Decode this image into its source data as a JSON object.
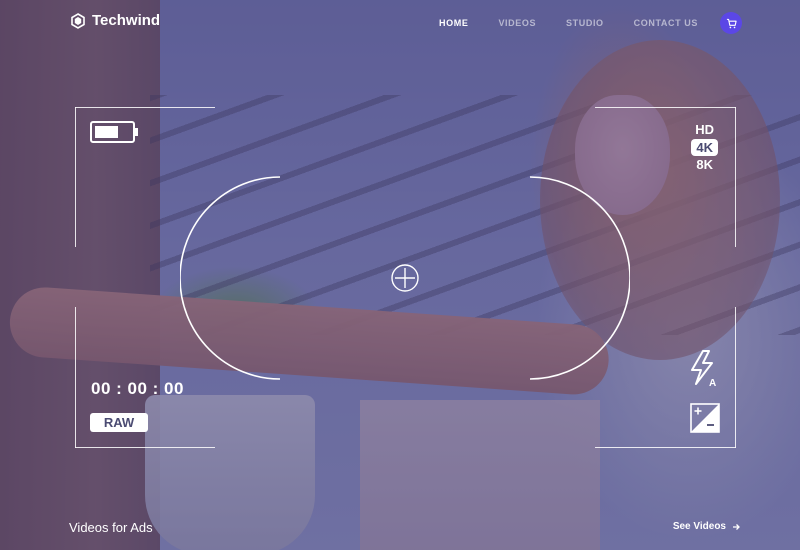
{
  "brand": {
    "name": "Techwind",
    "logo_icon": "techwind-logo-icon"
  },
  "nav": {
    "items": [
      {
        "label": "HOME",
        "active": true
      },
      {
        "label": "VIDEOS",
        "active": false
      },
      {
        "label": "STUDIO",
        "active": false
      },
      {
        "label": "CONTACT US",
        "active": false
      }
    ],
    "cart_icon": "cart-icon",
    "accent": "#5b47e6"
  },
  "camera": {
    "battery_icon": "battery-icon",
    "resolutions": [
      {
        "label": "HD",
        "selected": false
      },
      {
        "label": "4K",
        "selected": true
      },
      {
        "label": "8K",
        "selected": false
      }
    ],
    "timecode": "00 : 00 : 00",
    "format": "RAW",
    "flash_icon": "flash-auto-icon",
    "flash_mode": "A",
    "exposure_icon": "exposure-compensation-icon",
    "focus_icon": "focus-crosshair-icon"
  },
  "section": {
    "title": "Videos for Ads",
    "link_label": "See Videos",
    "link_icon": "arrow-right-icon"
  }
}
